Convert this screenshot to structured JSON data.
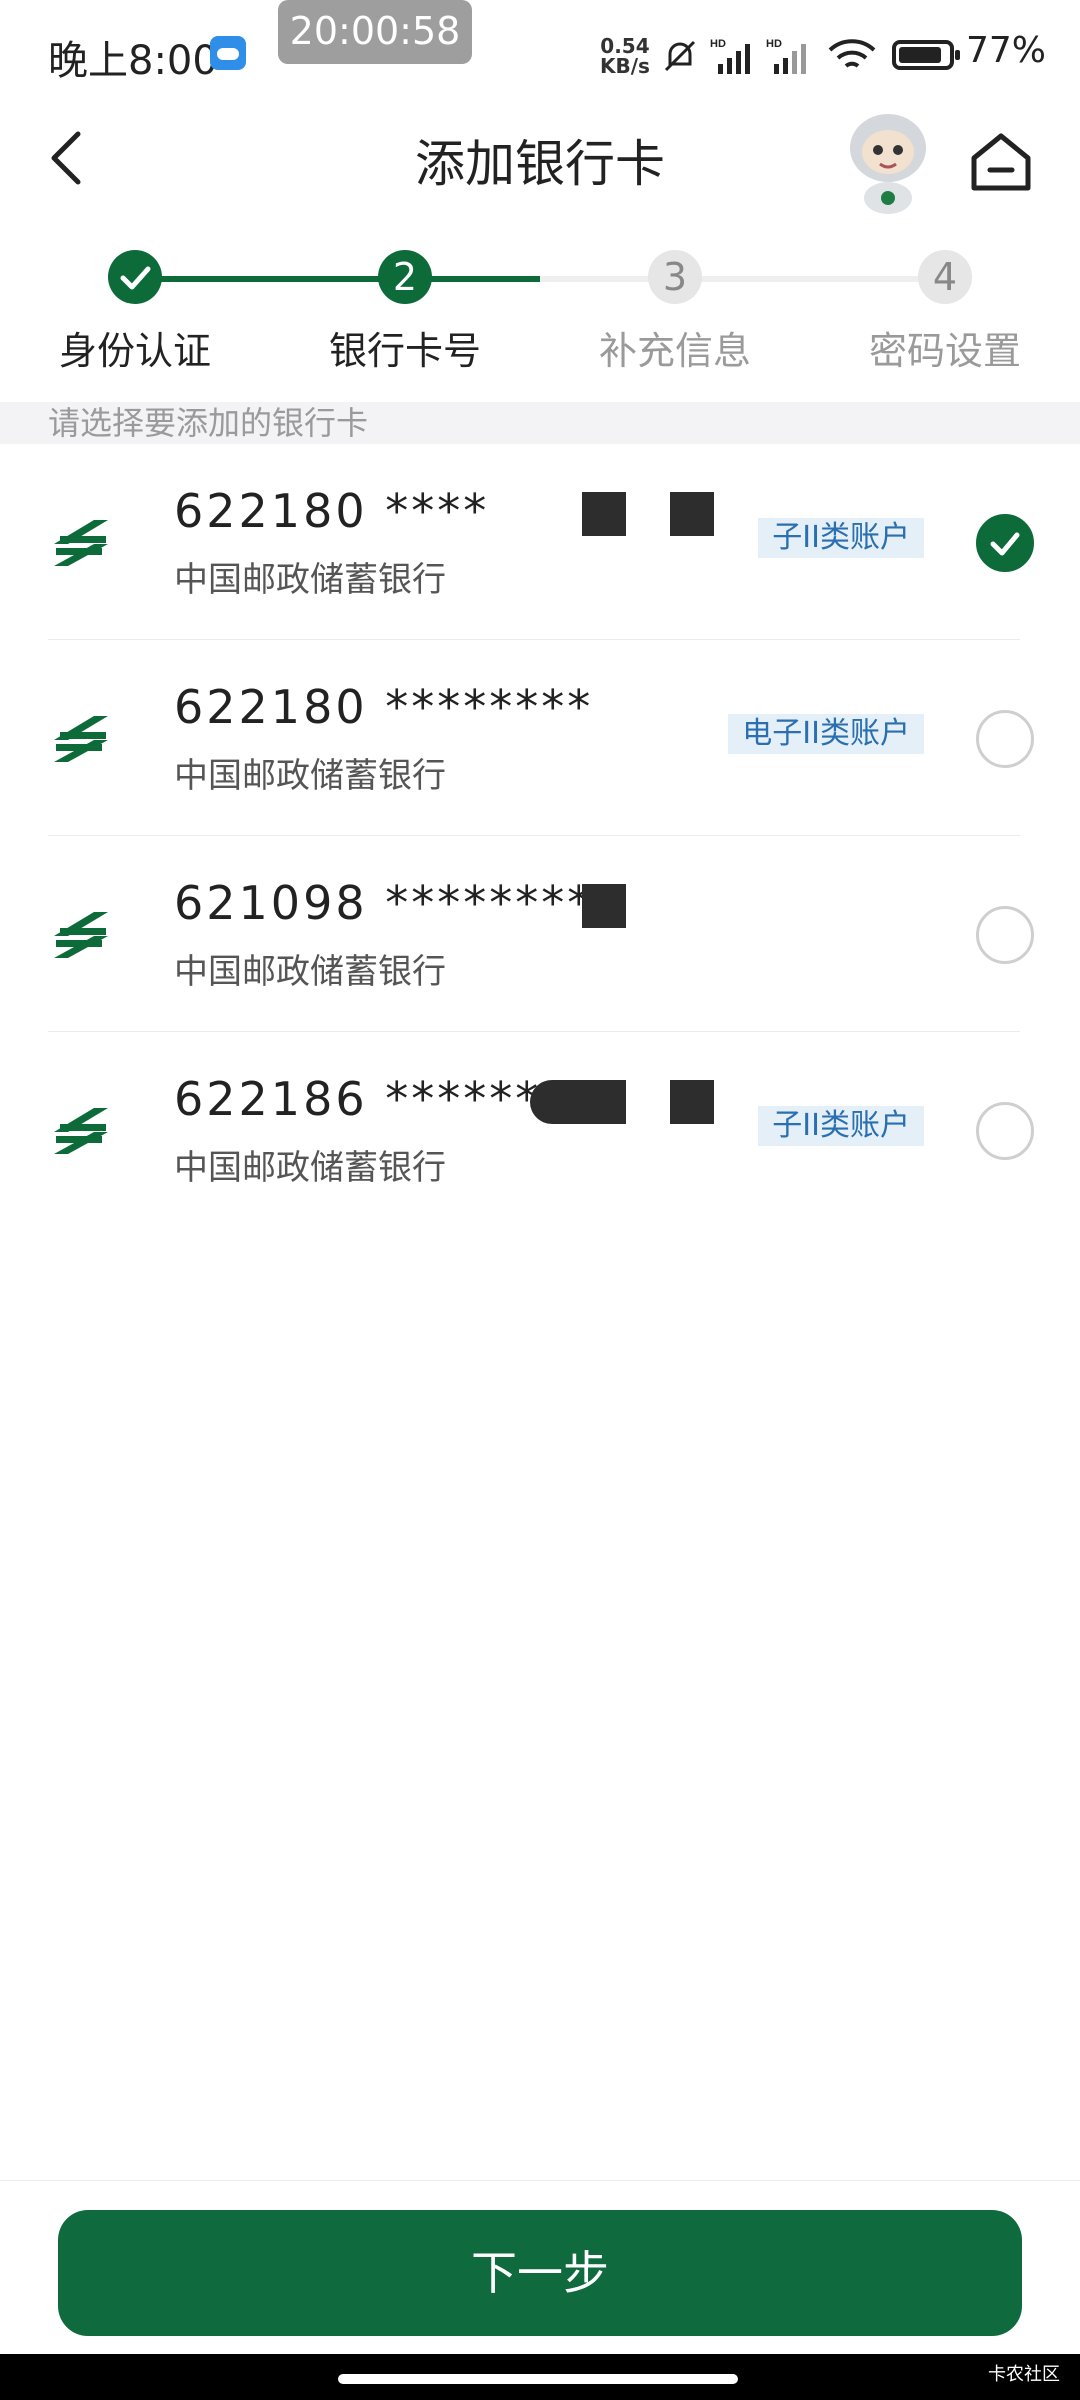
{
  "status_bar": {
    "time": "晚上8:00",
    "recording_time": "20:00:58",
    "net_speed_value": "0.54",
    "net_speed_unit": "KB/s",
    "battery": "77%"
  },
  "header": {
    "title": "添加银行卡"
  },
  "steps": [
    {
      "number": "1",
      "label": "身份认证",
      "state": "done"
    },
    {
      "number": "2",
      "label": "银行卡号",
      "state": "current"
    },
    {
      "number": "3",
      "label": "补充信息",
      "state": "pending"
    },
    {
      "number": "4",
      "label": "密码设置",
      "state": "pending"
    }
  ],
  "section": {
    "prompt": "请选择要添加的银行卡"
  },
  "cards": [
    {
      "number": "622180 ****",
      "bank": "中国邮政储蓄银行",
      "tag": "子II类账户",
      "selected": true
    },
    {
      "number": "622180 ********",
      "bank": "中国邮政储蓄银行",
      "tag": "电子II类账户",
      "selected": false
    },
    {
      "number": "621098 ********",
      "bank": "中国邮政储蓄银行",
      "tag": "",
      "selected": false
    },
    {
      "number": "622186 *******",
      "bank": "中国邮政储蓄银行",
      "tag": "子II类账户",
      "selected": false
    }
  ],
  "footer": {
    "next_label": "下一步",
    "watermark": "卡农社区"
  },
  "colors": {
    "brand_green": "#0d6b3a",
    "tag_bg": "#e4eff8",
    "tag_text": "#2a6fb0"
  },
  "icons": {
    "back": "chevron-left-icon",
    "home": "home-icon",
    "bank_logo": "postal-savings-logo-icon",
    "check": "check-icon"
  }
}
